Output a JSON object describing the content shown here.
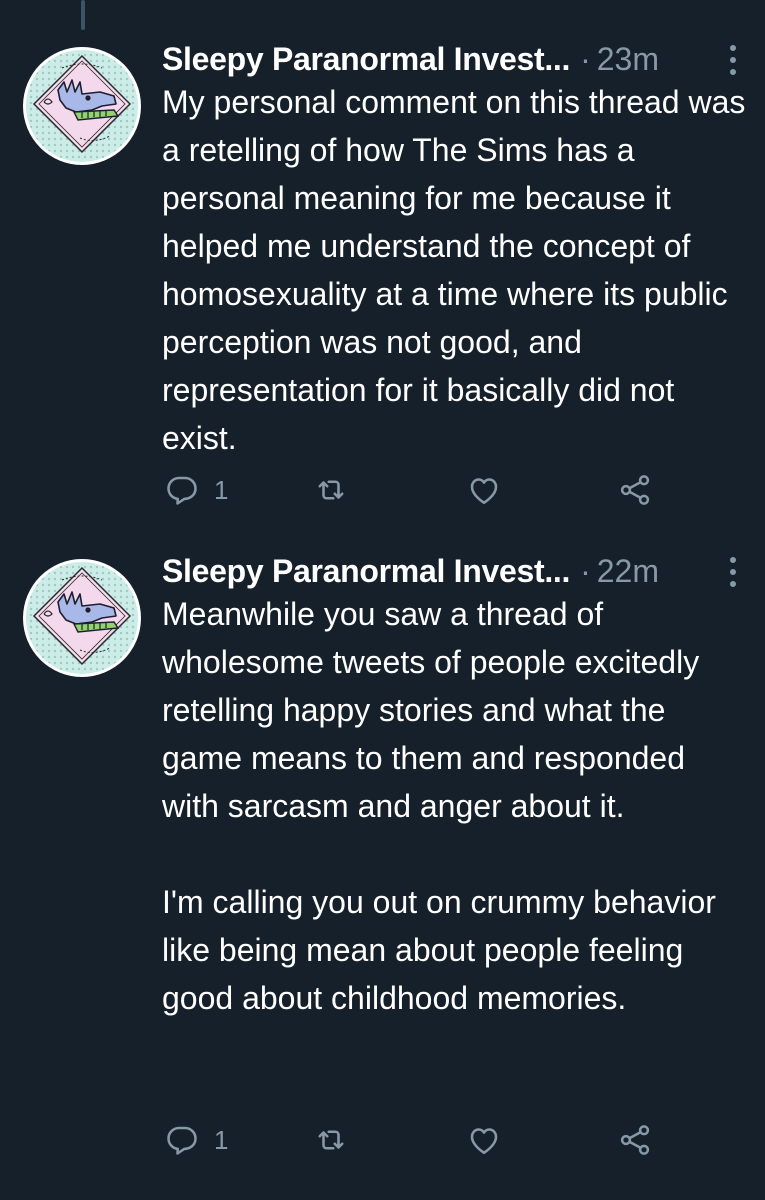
{
  "tweets": [
    {
      "author_name": "Sleepy Paranormal Invest...",
      "separator": "·",
      "time": "23m",
      "paragraphs": [
        "My personal comment on this thread was a retelling of how The Sims has a personal meaning for me because it helped me understand the concept of homosexuality at a time where its public perception was not good, and representation for it basically did not exist."
      ],
      "reply_count": "1",
      "icons": [
        "reply-icon",
        "retweet-icon",
        "like-icon",
        "share-icon",
        "more-options-icon"
      ]
    },
    {
      "author_name": "Sleepy Paranormal Invest...",
      "separator": "·",
      "time": "22m",
      "paragraphs": [
        "Meanwhile you saw a thread of wholesome tweets of people excitedly retelling happy stories and what the game means to them and responded with sarcasm and anger about it.",
        "I'm calling you out on crummy behavior like being mean about people feeling good about childhood memories."
      ],
      "reply_count": "1",
      "icons": [
        "reply-icon",
        "retweet-icon",
        "like-icon",
        "share-icon",
        "more-options-icon"
      ]
    }
  ],
  "colors": {
    "background": "#15202b",
    "text_primary": "#ffffff",
    "text_secondary": "#8899a6",
    "thread_line": "#3d5466",
    "avatar_bg": "#ccece7",
    "avatar_ring": "#ffffff",
    "avatar_diamond": "#f4d9ec",
    "avatar_dragon": "#a8b8e8",
    "avatar_tongue": "#8fd46e"
  }
}
